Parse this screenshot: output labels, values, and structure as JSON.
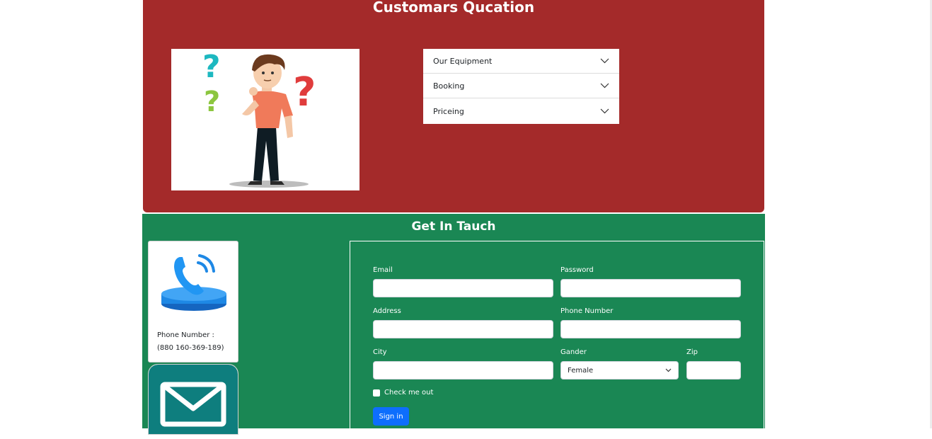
{
  "faq": {
    "title": "Customars Qucation",
    "items": [
      {
        "label": "Our Equipment",
        "icon": "chevron-down-icon"
      },
      {
        "label": "Booking",
        "icon": "chevron-down-icon"
      },
      {
        "label": "Priceing",
        "icon": "chevron-down-icon"
      }
    ]
  },
  "contact": {
    "title": "Get In Tauch",
    "phone_card": {
      "label": "Phone Number :",
      "number": "(880 160-369-189)",
      "icon": "phone-icon"
    },
    "mail_card": {
      "icon": "envelope-icon"
    },
    "form": {
      "email_label": "Email",
      "password_label": "Password",
      "address_label": "Address",
      "phone_label": "Phone Number",
      "city_label": "City",
      "gender_label": "Gander",
      "gender_value": "Female",
      "zip_label": "Zip",
      "checkbox_label": "Check me out",
      "submit_label": "Sign in"
    }
  },
  "colors": {
    "faq_bg": "#a42a2a",
    "contact_bg": "#1a8754",
    "button_bg": "#0d6efd",
    "mail_card_bg": "#0e7e7e"
  }
}
